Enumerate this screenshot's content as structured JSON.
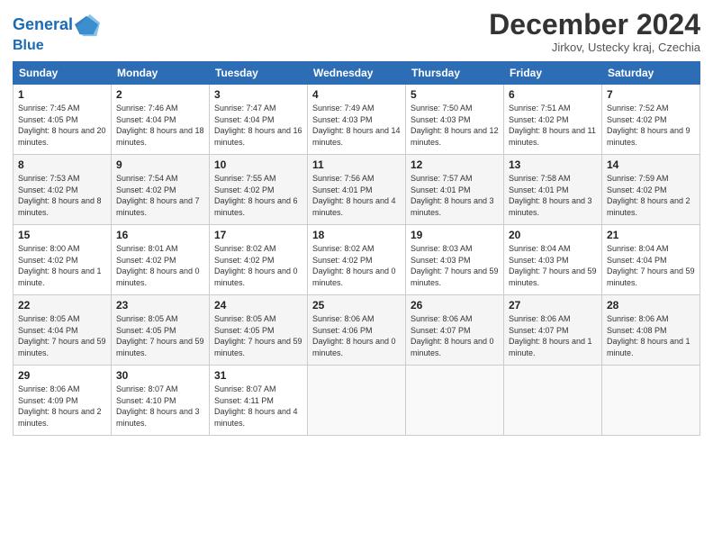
{
  "header": {
    "logo_line1": "General",
    "logo_line2": "Blue",
    "month": "December 2024",
    "location": "Jirkov, Ustecky kraj, Czechia"
  },
  "weekdays": [
    "Sunday",
    "Monday",
    "Tuesday",
    "Wednesday",
    "Thursday",
    "Friday",
    "Saturday"
  ],
  "weeks": [
    [
      {
        "day": "1",
        "sunrise": "Sunrise: 7:45 AM",
        "sunset": "Sunset: 4:05 PM",
        "daylight": "Daylight: 8 hours and 20 minutes."
      },
      {
        "day": "2",
        "sunrise": "Sunrise: 7:46 AM",
        "sunset": "Sunset: 4:04 PM",
        "daylight": "Daylight: 8 hours and 18 minutes."
      },
      {
        "day": "3",
        "sunrise": "Sunrise: 7:47 AM",
        "sunset": "Sunset: 4:04 PM",
        "daylight": "Daylight: 8 hours and 16 minutes."
      },
      {
        "day": "4",
        "sunrise": "Sunrise: 7:49 AM",
        "sunset": "Sunset: 4:03 PM",
        "daylight": "Daylight: 8 hours and 14 minutes."
      },
      {
        "day": "5",
        "sunrise": "Sunrise: 7:50 AM",
        "sunset": "Sunset: 4:03 PM",
        "daylight": "Daylight: 8 hours and 12 minutes."
      },
      {
        "day": "6",
        "sunrise": "Sunrise: 7:51 AM",
        "sunset": "Sunset: 4:02 PM",
        "daylight": "Daylight: 8 hours and 11 minutes."
      },
      {
        "day": "7",
        "sunrise": "Sunrise: 7:52 AM",
        "sunset": "Sunset: 4:02 PM",
        "daylight": "Daylight: 8 hours and 9 minutes."
      }
    ],
    [
      {
        "day": "8",
        "sunrise": "Sunrise: 7:53 AM",
        "sunset": "Sunset: 4:02 PM",
        "daylight": "Daylight: 8 hours and 8 minutes."
      },
      {
        "day": "9",
        "sunrise": "Sunrise: 7:54 AM",
        "sunset": "Sunset: 4:02 PM",
        "daylight": "Daylight: 8 hours and 7 minutes."
      },
      {
        "day": "10",
        "sunrise": "Sunrise: 7:55 AM",
        "sunset": "Sunset: 4:02 PM",
        "daylight": "Daylight: 8 hours and 6 minutes."
      },
      {
        "day": "11",
        "sunrise": "Sunrise: 7:56 AM",
        "sunset": "Sunset: 4:01 PM",
        "daylight": "Daylight: 8 hours and 4 minutes."
      },
      {
        "day": "12",
        "sunrise": "Sunrise: 7:57 AM",
        "sunset": "Sunset: 4:01 PM",
        "daylight": "Daylight: 8 hours and 3 minutes."
      },
      {
        "day": "13",
        "sunrise": "Sunrise: 7:58 AM",
        "sunset": "Sunset: 4:01 PM",
        "daylight": "Daylight: 8 hours and 3 minutes."
      },
      {
        "day": "14",
        "sunrise": "Sunrise: 7:59 AM",
        "sunset": "Sunset: 4:02 PM",
        "daylight": "Daylight: 8 hours and 2 minutes."
      }
    ],
    [
      {
        "day": "15",
        "sunrise": "Sunrise: 8:00 AM",
        "sunset": "Sunset: 4:02 PM",
        "daylight": "Daylight: 8 hours and 1 minute."
      },
      {
        "day": "16",
        "sunrise": "Sunrise: 8:01 AM",
        "sunset": "Sunset: 4:02 PM",
        "daylight": "Daylight: 8 hours and 0 minutes."
      },
      {
        "day": "17",
        "sunrise": "Sunrise: 8:02 AM",
        "sunset": "Sunset: 4:02 PM",
        "daylight": "Daylight: 8 hours and 0 minutes."
      },
      {
        "day": "18",
        "sunrise": "Sunrise: 8:02 AM",
        "sunset": "Sunset: 4:02 PM",
        "daylight": "Daylight: 8 hours and 0 minutes."
      },
      {
        "day": "19",
        "sunrise": "Sunrise: 8:03 AM",
        "sunset": "Sunset: 4:03 PM",
        "daylight": "Daylight: 7 hours and 59 minutes."
      },
      {
        "day": "20",
        "sunrise": "Sunrise: 8:04 AM",
        "sunset": "Sunset: 4:03 PM",
        "daylight": "Daylight: 7 hours and 59 minutes."
      },
      {
        "day": "21",
        "sunrise": "Sunrise: 8:04 AM",
        "sunset": "Sunset: 4:04 PM",
        "daylight": "Daylight: 7 hours and 59 minutes."
      }
    ],
    [
      {
        "day": "22",
        "sunrise": "Sunrise: 8:05 AM",
        "sunset": "Sunset: 4:04 PM",
        "daylight": "Daylight: 7 hours and 59 minutes."
      },
      {
        "day": "23",
        "sunrise": "Sunrise: 8:05 AM",
        "sunset": "Sunset: 4:05 PM",
        "daylight": "Daylight: 7 hours and 59 minutes."
      },
      {
        "day": "24",
        "sunrise": "Sunrise: 8:05 AM",
        "sunset": "Sunset: 4:05 PM",
        "daylight": "Daylight: 7 hours and 59 minutes."
      },
      {
        "day": "25",
        "sunrise": "Sunrise: 8:06 AM",
        "sunset": "Sunset: 4:06 PM",
        "daylight": "Daylight: 8 hours and 0 minutes."
      },
      {
        "day": "26",
        "sunrise": "Sunrise: 8:06 AM",
        "sunset": "Sunset: 4:07 PM",
        "daylight": "Daylight: 8 hours and 0 minutes."
      },
      {
        "day": "27",
        "sunrise": "Sunrise: 8:06 AM",
        "sunset": "Sunset: 4:07 PM",
        "daylight": "Daylight: 8 hours and 1 minute."
      },
      {
        "day": "28",
        "sunrise": "Sunrise: 8:06 AM",
        "sunset": "Sunset: 4:08 PM",
        "daylight": "Daylight: 8 hours and 1 minute."
      }
    ],
    [
      {
        "day": "29",
        "sunrise": "Sunrise: 8:06 AM",
        "sunset": "Sunset: 4:09 PM",
        "daylight": "Daylight: 8 hours and 2 minutes."
      },
      {
        "day": "30",
        "sunrise": "Sunrise: 8:07 AM",
        "sunset": "Sunset: 4:10 PM",
        "daylight": "Daylight: 8 hours and 3 minutes."
      },
      {
        "day": "31",
        "sunrise": "Sunrise: 8:07 AM",
        "sunset": "Sunset: 4:11 PM",
        "daylight": "Daylight: 8 hours and 4 minutes."
      },
      null,
      null,
      null,
      null
    ]
  ]
}
